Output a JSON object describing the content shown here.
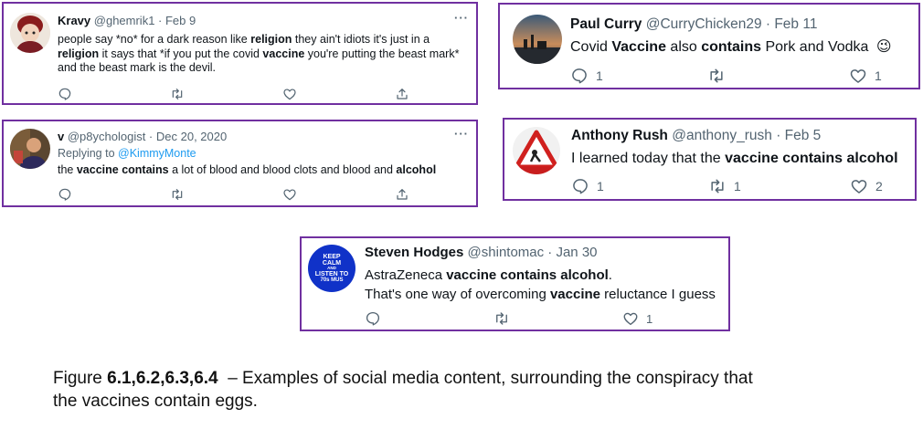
{
  "tweets": {
    "t1": {
      "name": "Kravy",
      "handle": "@ghemrik1 · Feb 9",
      "more": "···",
      "text": [
        "people say *no* for a dark reason like ",
        "religion",
        " they ain't idiots it's just in a ",
        "religion",
        " it says that *if you put the covid ",
        "vaccine",
        " you're putting the beast mark* and the beast mark is the devil."
      ],
      "counts": {
        "reply": "",
        "retweet": "",
        "like": ""
      }
    },
    "t2": {
      "name": "Paul Curry",
      "handle": "@CurryChicken29 · Feb 11",
      "text": [
        "Covid  ",
        "Vaccine",
        " also ",
        "contains",
        " Pork and Vodka"
      ],
      "emoji": "😉",
      "counts": {
        "reply": "1",
        "retweet": "",
        "like": "1"
      }
    },
    "t3": {
      "name": "v",
      "handle": "@p8ychologist · Dec 20, 2020",
      "more": "···",
      "replying_label": "Replying to ",
      "replying_to": "@KimmyMonte",
      "text": [
        "the ",
        "vaccine contains",
        " a lot of blood and blood clots and blood and ",
        "alcohol"
      ],
      "counts": {
        "reply": "",
        "retweet": "",
        "like": ""
      }
    },
    "t4": {
      "name": "Anthony Rush",
      "handle": "@anthony_rush · Feb 5",
      "text": [
        "I learned today that the ",
        "vaccine contains alcohol"
      ],
      "counts": {
        "reply": "1",
        "retweet": "1",
        "like": "2"
      }
    },
    "t5": {
      "name": "Steven Hodges",
      "handle": "@shintomac · Jan 30",
      "avatar_text": [
        "KEEP",
        "CALM",
        "AND",
        "LISTEN TO",
        "70s MUS"
      ],
      "text_line1": [
        "AstraZeneca ",
        "vaccine contains alcohol",
        "."
      ],
      "text_line2": [
        "That's one way of overcoming ",
        "vaccine",
        " reluctance I guess"
      ],
      "counts": {
        "reply": "",
        "retweet": "",
        "like": "1"
      }
    }
  },
  "caption": {
    "prefix": "Figure ",
    "bold": "6.1,6.2,6.3,6.4",
    "rest_line1": "  – Examples of social media content, surrounding the conspiracy that",
    "line2": "the vaccines contain eggs."
  },
  "colors": {
    "border": "#7030a0",
    "link": "#1d9bf0",
    "muted": "#536471"
  },
  "icons": [
    "reply-icon",
    "retweet-icon",
    "like-icon",
    "share-icon",
    "more-icon",
    "wink-emoji"
  ]
}
